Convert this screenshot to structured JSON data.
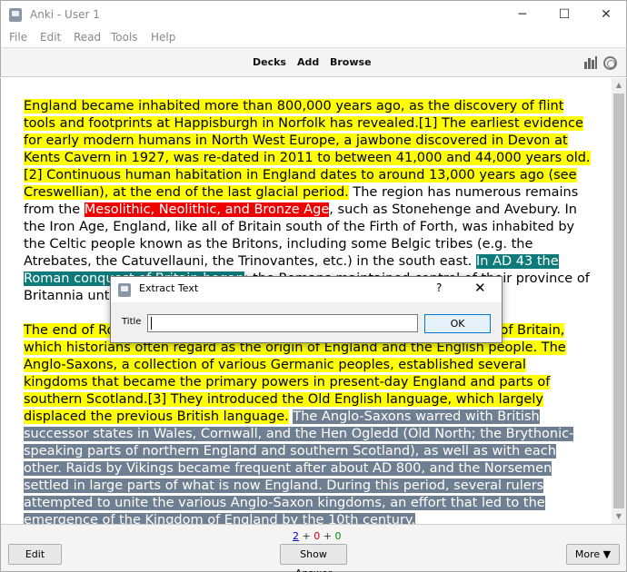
{
  "window": {
    "title": "Anki - User 1",
    "minimize_glyph": "─",
    "maximize_glyph": "☐",
    "close_glyph": "✕"
  },
  "menu": [
    "File",
    "Edit",
    "Read",
    "Tools",
    "Help"
  ],
  "toolbar": {
    "decks": "Decks",
    "add": "Add",
    "browse": "Browse",
    "icons": [
      "stats-icon",
      "sync-icon"
    ]
  },
  "content": {
    "para1": [
      {
        "text": "England became inhabited more than 800,000 years ago, as the discovery of flint tools and footprints at Happisburgh in Norfolk has revealed.[1] The earliest evidence for early modern humans in North West Europe, a jawbone discovered in Devon at Kents Cavern in 1927, was re-dated in 2011 to between 41,000 and 44,000 years old.[2] Continuous human habitation in England dates to around 13,000 years ago (see Creswellian), at the end of the last glacial period.",
        "style": "yellow"
      },
      {
        "text": " The region has numerous remains from the ",
        "style": "none"
      },
      {
        "text": "Mesolithic, Neolithic, and Bronze Age",
        "style": "red"
      },
      {
        "text": ", such as Stonehenge and Avebury. In the Iron Age, England, like all of Britain south of the Firth of Forth, was inhabited by the Celtic people known as the Britons, including some Belgic tribes (e.g. the Atrebates, the Catuvellauni, the Trinovantes, etc.) in the south east. ",
        "style": "none"
      },
      {
        "text": "In AD 43 the Roman conquest of Britain began",
        "style": "teal"
      },
      {
        "text": "; the Romans maintained control of their province of Britannia until the early 5th century.",
        "style": "none"
      }
    ],
    "para2": [
      {
        "text": "The end of Roman rule in Britain facilitated the Anglo-Saxon settlement of Britain, which historians often regard as the origin of England and the English people. The Anglo-Saxons, a collection of various Germanic peoples, established several kingdoms that became the primary powers in present-day England and parts of southern Scotland.[3] They introduced the Old English language, which largely displaced the previous British language.",
        "style": "yellow"
      },
      {
        "text": " ",
        "style": "none"
      },
      {
        "text": "The Anglo-Saxons warred with British successor states in Wales, Cornwall, and the Hen Ogledd (Old North; the Brythonic-speaking parts of northern England and southern Scotland), as well as with each other. Raids by Vikings became frequent after about AD 800, and the Norsemen settled in large parts of what is now England. During this period, several rulers attempted to unite the various Anglo-Saxon kingdoms, an effort that led to the emergence of the Kingdom of England by the 10th century.",
        "style": "gray"
      }
    ]
  },
  "bottom": {
    "edit": "Edit",
    "show_answer": "Show Answer",
    "more": "More ▼",
    "count_new": "2",
    "plus1": " + ",
    "count_learn": "0",
    "plus2": " + ",
    "count_review": "0"
  },
  "dialog": {
    "title": "Extract Text",
    "help": "?",
    "close_glyph": "✕",
    "label": "Title",
    "input_value": "",
    "ok": "OK"
  },
  "colors": {
    "highlight_yellow": "#ffff00",
    "highlight_red": "#ee0000",
    "highlight_teal": "#0e7a7a",
    "highlight_gray": "#6e7f91"
  }
}
